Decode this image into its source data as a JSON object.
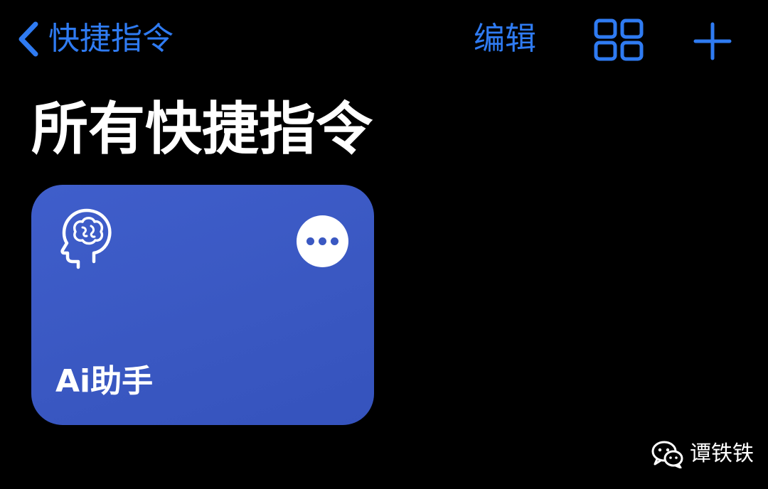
{
  "nav": {
    "back_label": "快捷指令",
    "back_icon": "chevron-left-icon",
    "edit_label": "编辑",
    "grid_icon": "grid-view-icon",
    "add_icon": "plus-icon"
  },
  "page": {
    "title": "所有快捷指令"
  },
  "shortcut": {
    "label": "Ai助手",
    "icon": "brain-head-icon",
    "more_icon": "ellipsis-icon"
  },
  "watermark": {
    "text": "谭铁铁",
    "icon": "wechat-icon"
  },
  "colors": {
    "background": "#000000",
    "accent": "#2f7bf2",
    "card": "#3a58c2",
    "text": "#ffffff"
  }
}
